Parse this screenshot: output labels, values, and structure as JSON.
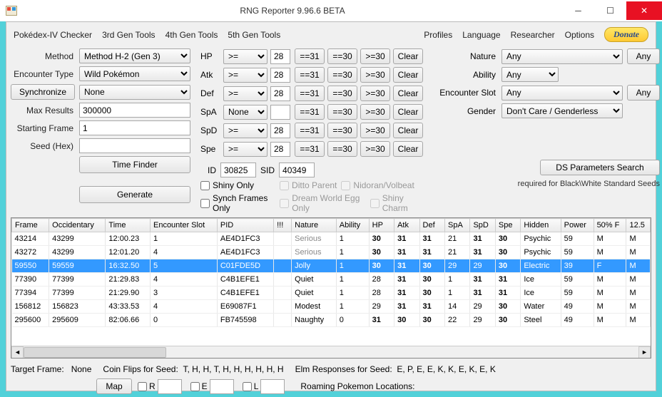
{
  "window": {
    "title": "RNG Reporter 9.96.6 BETA"
  },
  "menu": {
    "left": [
      "Pokédex-IV Checker",
      "3rd Gen Tools",
      "4th Gen Tools",
      "5th Gen Tools"
    ],
    "right": [
      "Profiles",
      "Language",
      "Researcher",
      "Options"
    ],
    "donate": "Donate"
  },
  "form": {
    "method": {
      "label": "Method",
      "value": "Method H-2 (Gen 3)"
    },
    "encounterType": {
      "label": "Encounter Type",
      "value": "Wild Pokémon"
    },
    "synchronize": {
      "label": "Synchronize",
      "value": "None"
    },
    "maxResults": {
      "label": "Max Results",
      "value": "300000"
    },
    "startingFrame": {
      "label": "Starting Frame",
      "value": "1"
    },
    "seed": {
      "label": "Seed (Hex)",
      "value": ""
    },
    "timeFinder": "Time Finder",
    "generate": "Generate"
  },
  "iv": {
    "stats": [
      {
        "name": "HP",
        "op": ">=",
        "val": "28"
      },
      {
        "name": "Atk",
        "op": ">=",
        "val": "28"
      },
      {
        "name": "Def",
        "op": ">=",
        "val": "28"
      },
      {
        "name": "SpA",
        "op": "None",
        "val": ""
      },
      {
        "name": "SpD",
        "op": ">=",
        "val": "28"
      },
      {
        "name": "Spe",
        "op": ">=",
        "val": "28"
      }
    ],
    "buttons": {
      "eq31": "==31",
      "eq30": "==30",
      "ge30": ">=30",
      "clear": "Clear"
    },
    "id": {
      "label": "ID",
      "value": "30825"
    },
    "sid": {
      "label": "SID",
      "value": "40349"
    },
    "checks": {
      "shinyOnly": "Shiny Only",
      "synchFrames": "Synch Frames Only",
      "ditto": "Ditto Parent",
      "nidoran": "Nidoran/Volbeat",
      "dreamWorld": "Dream World Egg Only",
      "shinyCharm": "Shiny Charm"
    }
  },
  "right": {
    "nature": {
      "label": "Nature",
      "value": "Any",
      "any": "Any"
    },
    "ability": {
      "label": "Ability",
      "value": "Any"
    },
    "encounterSlot": {
      "label": "Encounter Slot",
      "value": "Any",
      "any": "Any"
    },
    "gender": {
      "label": "Gender",
      "value": "Don't Care / Genderless"
    },
    "dsParams": "DS Parameters Search",
    "note": "required for Black\\White Standard Seeds"
  },
  "grid": {
    "columns": [
      "Frame",
      "Occidentary",
      "Time",
      "Encounter Slot",
      "PID",
      "!!!",
      "Nature",
      "Ability",
      "HP",
      "Atk",
      "Def",
      "SpA",
      "SpD",
      "Spe",
      "Hidden",
      "Power",
      "50% F",
      "12.5"
    ],
    "rows": [
      {
        "selected": false,
        "cells": [
          "43214",
          "43299",
          "12:00.23",
          "1",
          "AE4D1FC3",
          "",
          "Serious",
          "1",
          "30",
          "31",
          "31",
          "21",
          "31",
          "30",
          "Psychic",
          "59",
          "M",
          "M"
        ],
        "natureGray": true
      },
      {
        "selected": false,
        "cells": [
          "43272",
          "43299",
          "12:01.20",
          "4",
          "AE4D1FC3",
          "",
          "Serious",
          "1",
          "30",
          "31",
          "31",
          "21",
          "31",
          "30",
          "Psychic",
          "59",
          "M",
          "M"
        ],
        "natureGray": true
      },
      {
        "selected": true,
        "cells": [
          "59550",
          "59559",
          "16:32.50",
          "5",
          "C01FDE5D",
          "",
          "Jolly",
          "1",
          "30",
          "31",
          "30",
          "29",
          "29",
          "30",
          "Electric",
          "39",
          "F",
          "M"
        ],
        "natureGray": false
      },
      {
        "selected": false,
        "cells": [
          "77390",
          "77399",
          "21:29.83",
          "4",
          "C4B1EFE1",
          "",
          "Quiet",
          "1",
          "28",
          "31",
          "30",
          "1",
          "31",
          "31",
          "Ice",
          "59",
          "M",
          "M"
        ],
        "natureGray": false
      },
      {
        "selected": false,
        "cells": [
          "77394",
          "77399",
          "21:29.90",
          "3",
          "C4B1EFE1",
          "",
          "Quiet",
          "1",
          "28",
          "31",
          "30",
          "1",
          "31",
          "31",
          "Ice",
          "59",
          "M",
          "M"
        ],
        "natureGray": false
      },
      {
        "selected": false,
        "cells": [
          "156812",
          "156823",
          "43:33.53",
          "4",
          "E69087F1",
          "",
          "Modest",
          "1",
          "29",
          "31",
          "31",
          "14",
          "29",
          "30",
          "Water",
          "49",
          "M",
          "M"
        ],
        "natureGray": false
      },
      {
        "selected": false,
        "cells": [
          "295600",
          "295609",
          "82:06.66",
          "0",
          "FB745598",
          "",
          "Naughty",
          "0",
          "31",
          "30",
          "30",
          "22",
          "29",
          "30",
          "Steel",
          "49",
          "M",
          "M"
        ],
        "natureGray": false
      }
    ],
    "boldCols": [
      8,
      9,
      10,
      12,
      13
    ]
  },
  "footer": {
    "targetFrame": {
      "label": "Target Frame:",
      "value": "None"
    },
    "coinFlips": {
      "label": "Coin Flips for Seed:",
      "value": "T, H, H, T, H, H, H, H, H, H"
    },
    "elm": {
      "label": "Elm Responses for Seed:",
      "value": "E, P, E, E, K, K, E, K, E, K"
    },
    "map": "Map",
    "r": "R",
    "e": "E",
    "l": "L",
    "roaming": "Roaming Pokemon Locations:"
  }
}
